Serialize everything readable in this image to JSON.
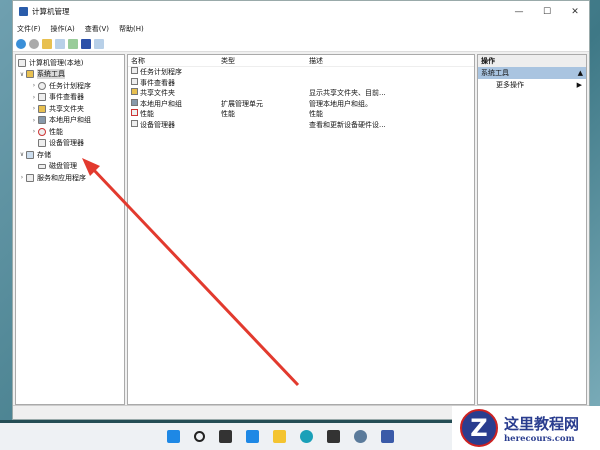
{
  "window": {
    "title": "计算机管理",
    "minimize": "—",
    "maximize": "☐",
    "close": "✕"
  },
  "menu": [
    "文件(F)",
    "操作(A)",
    "查看(V)",
    "帮助(H)"
  ],
  "tree": [
    {
      "label": "计算机管理(本地)",
      "expander": ""
    },
    {
      "label": "系统工具",
      "expander": "∨"
    },
    {
      "label": "任务计划程序",
      "expander": "›"
    },
    {
      "label": "事件查看器",
      "expander": "›"
    },
    {
      "label": "共享文件夹",
      "expander": "›"
    },
    {
      "label": "本地用户和组",
      "expander": "›"
    },
    {
      "label": "性能",
      "expander": "›"
    },
    {
      "label": "设备管理器",
      "expander": ""
    },
    {
      "label": "存储",
      "expander": "∨"
    },
    {
      "label": "磁盘管理",
      "expander": ""
    },
    {
      "label": "服务和应用程序",
      "expander": "›"
    }
  ],
  "list": {
    "headers": [
      "名称",
      "类型",
      "描述"
    ],
    "rows": [
      [
        "任务计划程序",
        "",
        ""
      ],
      [
        "事件查看器",
        "",
        ""
      ],
      [
        "共享文件夹",
        "",
        "显示共享文件夹、目前..."
      ],
      [
        "本地用户和组",
        "扩展管理单元",
        "管理本地用户和组。"
      ],
      [
        "性能",
        "性能",
        "性能"
      ],
      [
        "设备管理器",
        "",
        "查看和更新设备硬件设..."
      ]
    ]
  },
  "actions": {
    "header": "操作",
    "section": "系统工具",
    "section_arrow": "▲",
    "item": "更多操作",
    "item_arrow": "▶"
  },
  "watermark": {
    "letter": "Z",
    "title": "这里教程网",
    "url": "herecours.com"
  },
  "colors": {
    "accent": "#a9c4e0",
    "arrow": "#e23a2e"
  }
}
